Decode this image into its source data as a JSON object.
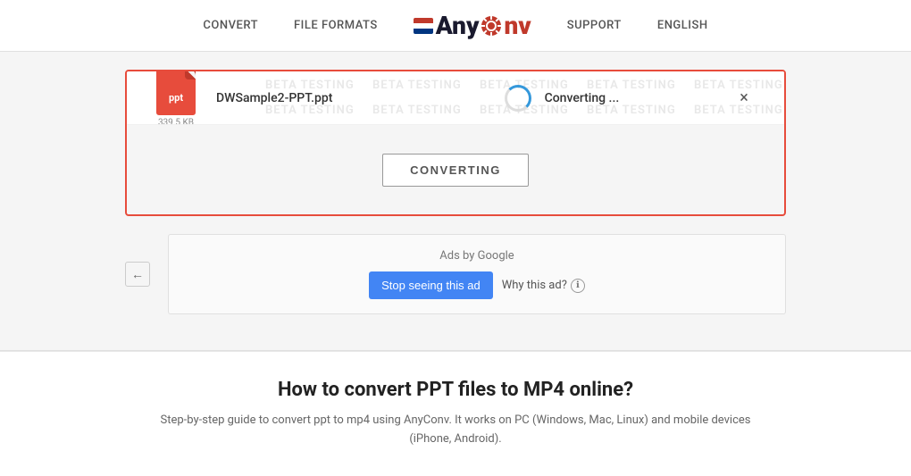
{
  "header": {
    "nav": {
      "convert": "CONVERT",
      "file_formats": "FILE FORMATS",
      "support": "SUPPORT",
      "english": "ENGLISH"
    },
    "logo": {
      "any": "Any",
      "conv": "Conv"
    }
  },
  "watermark": {
    "text": "BETA TESTING"
  },
  "file": {
    "name": "DWSample2-PPT.ppt",
    "ext": "ppt",
    "size": "339.5 KB"
  },
  "status": {
    "converting_label": "Converting ...",
    "close_symbol": "×"
  },
  "converting_button": {
    "label": "CONVERTING"
  },
  "ad": {
    "back_arrow": "←",
    "ads_by": "Ads by Google",
    "stop_label": "Stop seeing this ad",
    "why_label": "Why this ad?",
    "why_info": "ℹ"
  },
  "bottom": {
    "title": "How to convert PPT files to MP4 online?",
    "description": "Step-by-step guide to convert ppt to mp4 using AnyConv. It works on PC (Windows, Mac, Linux) and mobile devices (iPhone, Android)."
  }
}
